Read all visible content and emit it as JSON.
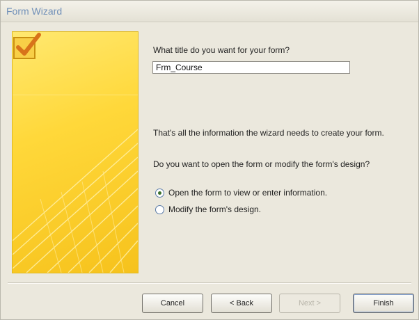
{
  "window": {
    "title": "Form Wizard"
  },
  "prompt": "What title do you want for your form?",
  "title_input": {
    "value": "Frm_Course"
  },
  "info_text": "That's all the information the wizard needs to create your form.",
  "question": "Do you want to open the form or modify the form's design?",
  "options": [
    {
      "label": "Open the form to view or enter information.",
      "selected": true
    },
    {
      "label": "Modify the form's design.",
      "selected": false
    }
  ],
  "buttons": {
    "cancel": "Cancel",
    "back": "< Back",
    "next": "Next >",
    "finish": "Finish"
  }
}
